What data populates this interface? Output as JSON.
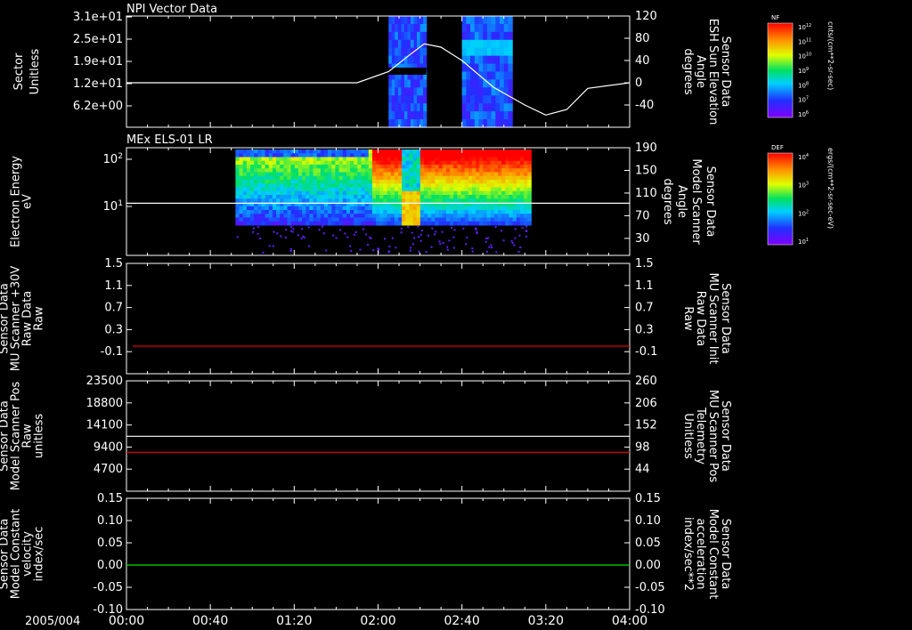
{
  "colors": {
    "background": "#000000",
    "axes": "#ffffff",
    "red_trace": "#e00000",
    "green_trace": "#00e000",
    "white_trace": "#ffffff"
  },
  "chart_data": [
    {
      "type": "heatmap",
      "title": "NPI Vector Data",
      "ylabel_lines": [
        "Sector",
        "Unitless"
      ],
      "yticks": [
        "3.1e+01",
        "2.5e+01",
        "1.9e+01",
        "1.2e+01",
        "6.2e+00"
      ],
      "right_axis": {
        "label_lines": [
          "Sensor Data",
          "ESH Sun Elevation",
          "Angle",
          "degrees"
        ],
        "yticks": [
          "120",
          "80",
          "40",
          "0",
          "-40"
        ],
        "ylim": [
          -80,
          120
        ]
      },
      "overlay_line": {
        "color": "#ffffff",
        "x_minutes": [
          0,
          60,
          110,
          125,
          135,
          142,
          150,
          160,
          175,
          190,
          200,
          210,
          220,
          240
        ],
        "y": [
          0,
          0,
          0,
          20,
          50,
          70,
          64,
          40,
          -8,
          -40,
          -58,
          -48,
          -10,
          0
        ]
      },
      "colorbar": {
        "label": "NF",
        "unit": "cnts/(cm**2-sr-sec)",
        "ticks": [
          "10^12",
          "10^11",
          "10^10",
          "10^9",
          "10^8",
          "10^7",
          "10^6"
        ]
      }
    },
    {
      "type": "heatmap",
      "title": "MEx ELS-01 LR",
      "ylabel_lines": [
        "Electron Energy",
        "eV"
      ],
      "yticks": [
        "10^2",
        "10^1"
      ],
      "right_axis": {
        "label_lines": [
          "Sensor Data",
          "Model Scanner",
          "Angle",
          "degrees"
        ],
        "yticks": [
          "190",
          "150",
          "110",
          "70",
          "30"
        ],
        "ylim": [
          0,
          190
        ]
      },
      "overlay_line": {
        "color": "#ffffff",
        "x_minutes": [
          0,
          240
        ],
        "y": [
          92,
          92
        ]
      },
      "colorbar": {
        "label": "DEF",
        "unit": "ergs/(cm**2-sr-sec-eV)",
        "ticks": [
          "10^4",
          "10^3",
          "10^2",
          "10^1"
        ]
      }
    },
    {
      "type": "line",
      "ylabel_lines": [
        "Sensor Data",
        "MU Scanner +30V",
        "Raw Data",
        "Raw"
      ],
      "yticks": [
        "1.5",
        "1.1",
        "0.7",
        "0.3",
        "-0.1"
      ],
      "ylim": [
        -0.5,
        1.5
      ],
      "right_axis": {
        "label_lines": [
          "Sensor Data",
          "MU Scanner Init",
          "Raw Data",
          "Raw"
        ],
        "yticks": [
          "1.5",
          "1.1",
          "0.7",
          "0.3",
          "-0.1"
        ],
        "ylim": [
          -0.5,
          1.5
        ]
      },
      "series": [
        {
          "axis": "right",
          "color": "#e00000",
          "x_minutes": [
            3,
            240
          ],
          "y": [
            0.0,
            0.0
          ]
        }
      ]
    },
    {
      "type": "line",
      "ylabel_lines": [
        "Sensor Data",
        "Model Scanner Pos",
        "Raw",
        "unitless"
      ],
      "yticks": [
        "23500",
        "18800",
        "14100",
        "9400",
        "4700"
      ],
      "ylim": [
        0,
        23500
      ],
      "right_axis": {
        "label_lines": [
          "Sensor Data",
          "MU Scanner Pos",
          "Telemetry",
          "Unitless"
        ],
        "yticks": [
          "260",
          "206",
          "152",
          "98",
          "44"
        ],
        "ylim": [
          -10,
          260
        ]
      },
      "series": [
        {
          "axis": "left",
          "color": "#ffffff",
          "x_minutes": [
            0,
            240
          ],
          "y": [
            11700,
            11700
          ]
        },
        {
          "axis": "right",
          "color": "#e00000",
          "x_minutes": [
            0,
            240
          ],
          "y": [
            85,
            85
          ]
        }
      ]
    },
    {
      "type": "line",
      "ylabel_lines": [
        "Sensor Data",
        "Model Constant",
        "velocity",
        "index/sec"
      ],
      "yticks": [
        "0.15",
        "0.10",
        "0.05",
        "0.00",
        "-0.05",
        "-0.10"
      ],
      "ylim": [
        -0.1,
        0.15
      ],
      "right_axis": {
        "label_lines": [
          "Sensor Data",
          "Model Constant",
          "acceleration",
          "index/sec**2"
        ],
        "yticks": [
          "0.15",
          "0.10",
          "0.05",
          "0.00",
          "-0.05",
          "-0.10"
        ],
        "ylim": [
          -0.1,
          0.15
        ]
      },
      "series": [
        {
          "axis": "right",
          "color": "#00e000",
          "x_minutes": [
            0,
            240
          ],
          "y": [
            0.0,
            0.0
          ]
        }
      ]
    }
  ],
  "xaxis": {
    "date": "2005/004",
    "ticks": [
      "00:00",
      "00:40",
      "01:20",
      "02:00",
      "02:40",
      "03:20",
      "04:00"
    ],
    "range_minutes": [
      0,
      240
    ]
  }
}
